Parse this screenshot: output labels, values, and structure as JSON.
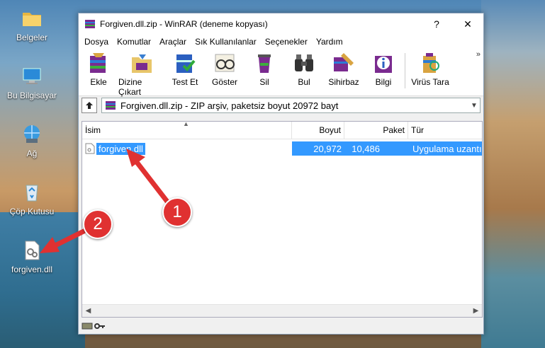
{
  "desktop": {
    "icons": [
      {
        "label": "Belgeler",
        "icon": "folder-icon"
      },
      {
        "label": "Bu Bilgisayar",
        "icon": "computer-icon"
      },
      {
        "label": "Ağ",
        "icon": "network-icon"
      },
      {
        "label": "Çöp Kutusu",
        "icon": "recycle-bin-icon"
      },
      {
        "label": "forgiven.dll",
        "icon": "dll-file-icon"
      }
    ]
  },
  "window": {
    "title": "Forgiven.dll.zip - WinRAR (deneme kopyası)",
    "help_btn": "?",
    "close_btn": "✕",
    "menu": [
      "Dosya",
      "Komutlar",
      "Araçlar",
      "Sık Kullanılanlar",
      "Seçenekler",
      "Yardım"
    ],
    "toolbar": [
      "Ekle",
      "Dizine Çıkart",
      "Test Et",
      "Göster",
      "Sil",
      "Bul",
      "Sihirbaz",
      "Bilgi",
      "Virüs Tara"
    ],
    "toolbar_more": "»",
    "address": "Forgiven.dll.zip - ZIP arşiv, paketsiz boyut 20972 bayt",
    "columns": {
      "name": "İsim",
      "size": "Boyut",
      "packed": "Paket",
      "type": "Tür"
    },
    "files": [
      {
        "name": "forgiven.dll",
        "size": "20,972",
        "packed": "10,486",
        "type": "Uygulama uzantısı"
      }
    ]
  },
  "annotations": {
    "step1": "1",
    "step2": "2",
    "color": "#e03131"
  }
}
